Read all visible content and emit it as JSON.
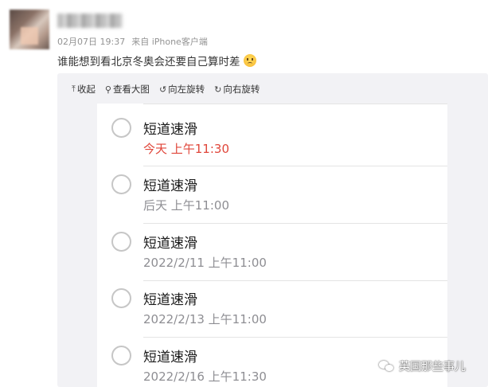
{
  "post": {
    "date": "02月07日 19:37",
    "source": "来自 iPhone客户端",
    "text": "谁能想到看北京冬奥会还要自己算时差"
  },
  "toolbar": {
    "collapse": "收起",
    "view_large": "查看大图",
    "rotate_left": "向左旋转",
    "rotate_right": "向右旋转"
  },
  "reminders": [
    {
      "title": "短道速滑",
      "time": "今天 上午11:30",
      "overdue": true
    },
    {
      "title": "短道速滑",
      "time": "后天 上午11:00",
      "overdue": false
    },
    {
      "title": "短道速滑",
      "time": "2022/2/11 上午11:00",
      "overdue": false
    },
    {
      "title": "短道速滑",
      "time": "2022/2/13 上午11:00",
      "overdue": false
    },
    {
      "title": "短道速滑",
      "time": "2022/2/16 上午11:30",
      "overdue": false
    }
  ],
  "watermark": "英国那些事儿",
  "colors": {
    "overdue": "#e0463a",
    "muted": "#8e8e93"
  }
}
